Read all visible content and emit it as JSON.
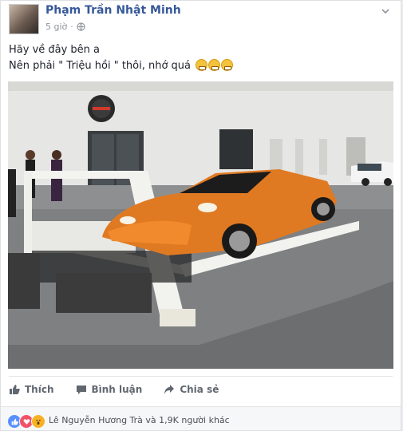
{
  "post": {
    "author": "Phạm Trần Nhật Minh",
    "time": "5 giờ",
    "text_line1": "Hãy về đây bên a",
    "text_line2": "Nên phải \" Triệu hồi \" thôi, nhớ quá",
    "emoji_count": 3,
    "emoji_icon": "grinning-face-icon",
    "photo_icon": "orange-supercar-on-tow-truck-photo"
  },
  "actions": {
    "like": "Thích",
    "comment": "Bình luận",
    "share": "Chia sẻ"
  },
  "reactions": {
    "summary": "Lê Nguyễn Hương Trà và 1,9K người khác",
    "types": [
      "like",
      "love",
      "wow"
    ]
  },
  "colors": {
    "name": "#365899",
    "meta": "#90949c",
    "action": "#616770",
    "like": "#5890ff",
    "love": "#f25268",
    "wow": "#f7b125"
  }
}
